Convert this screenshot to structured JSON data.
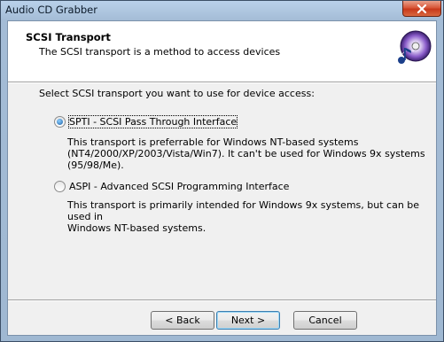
{
  "window": {
    "title": "Audio CD Grabber",
    "close_icon": "close-icon"
  },
  "header": {
    "title": "SCSI Transport",
    "subtitle": "The SCSI transport is a method to access devices",
    "icon": "cd-music-icon"
  },
  "main": {
    "prompt": "Select SCSI transport you want to use for device access:",
    "options": [
      {
        "label": "SPTI - SCSI Pass Through Interface",
        "selected": true,
        "description_lines": [
          "This transport is preferrable for Windows NT-based systems",
          "(NT4/2000/XP/2003/Vista/Win7). It can't be used for Windows 9x systems",
          "(95/98/Me)."
        ]
      },
      {
        "label": "ASPI - Advanced SCSI Programming Interface",
        "selected": false,
        "description_lines": [
          "This transport is primarily intended for Windows 9x systems, but can be used in",
          "Windows NT-based systems."
        ]
      }
    ]
  },
  "footer": {
    "back_label": "< Back",
    "next_label": "Next >",
    "cancel_label": "Cancel"
  }
}
